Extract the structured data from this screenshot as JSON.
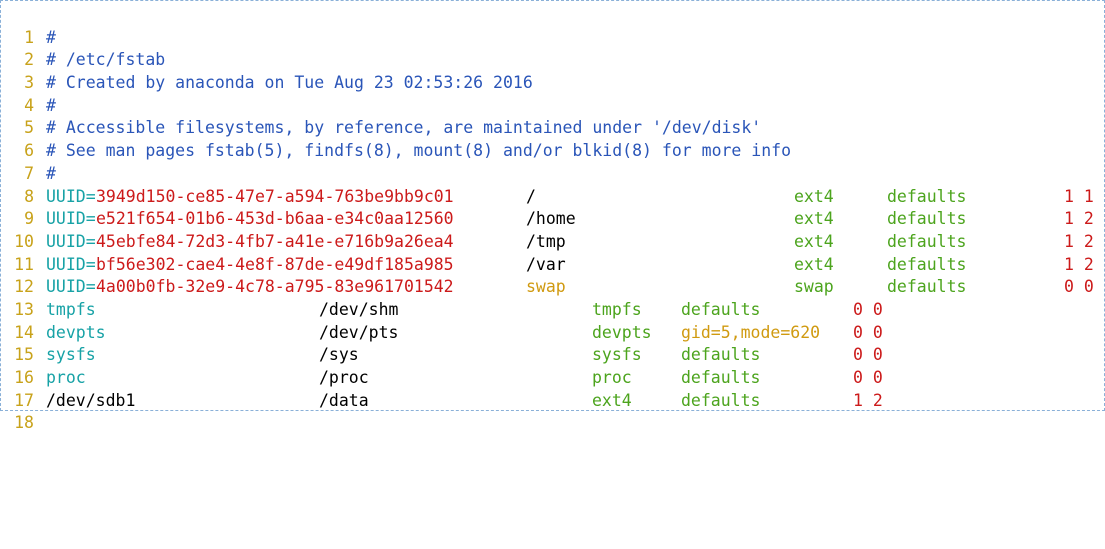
{
  "editor": {
    "line_numbers": [
      "1",
      "2",
      "3",
      "4",
      "5",
      "6",
      "7",
      "8",
      "9",
      "10",
      "11",
      "12",
      "13",
      "14",
      "15",
      "16",
      "17",
      "18"
    ],
    "comments": {
      "l2": "#",
      "l3": "# /etc/fstab",
      "l4": "# Created by anaconda on Tue Aug 23 02:53:26 2016",
      "l5": "#",
      "l6": "# Accessible filesystems, by reference, are maintained under '/dev/disk'",
      "l7": "# See man pages fstab(5), findfs(8), mount(8) and/or blkid(8) for more info",
      "l8": "#"
    },
    "uuid_rows": [
      {
        "key": "UUID=",
        "uuid": "3949d150-ce85-47e7-a594-763be9bb9c01",
        "mount": "/",
        "type": "ext4",
        "options": "defaults",
        "dump_pass": "1 1"
      },
      {
        "key": "UUID=",
        "uuid": "e521f654-01b6-453d-b6aa-e34c0aa12560",
        "mount": "/home",
        "type": "ext4",
        "options": "defaults",
        "dump_pass": "1 2"
      },
      {
        "key": "UUID=",
        "uuid": "45ebfe84-72d3-4fb7-a41e-e716b9a26ea4",
        "mount": "/tmp",
        "type": "ext4",
        "options": "defaults",
        "dump_pass": "1 2"
      },
      {
        "key": "UUID=",
        "uuid": "bf56e302-cae4-4e8f-87de-e49df185a985",
        "mount": "/var",
        "type": "ext4",
        "options": "defaults",
        "dump_pass": "1 2"
      },
      {
        "key": "UUID=",
        "uuid": "4a00b0fb-32e9-4c78-a795-83e961701542",
        "mount": "swap",
        "type": "swap",
        "options": "defaults",
        "dump_pass": "0 0"
      }
    ],
    "pseudo_rows": [
      {
        "device": "tmpfs",
        "mount": "/dev/shm",
        "type": "tmpfs",
        "options": "defaults",
        "dump_pass": "0 0"
      },
      {
        "device": "devpts",
        "mount": "/dev/pts",
        "type": "devpts",
        "options": "gid=5,mode=620",
        "dump_pass": "0 0"
      },
      {
        "device": "sysfs",
        "mount": "/sys",
        "type": "sysfs",
        "options": "defaults",
        "dump_pass": "0 0"
      },
      {
        "device": "proc",
        "mount": "/proc",
        "type": "proc",
        "options": "defaults",
        "dump_pass": "0 0"
      },
      {
        "device": "/dev/sdb1",
        "mount": "/data",
        "type": "ext4",
        "options": "defaults",
        "dump_pass": "1 2"
      }
    ]
  },
  "colors": {
    "line_number": "#c8a21a",
    "comment": "#2a55b8",
    "keyword": "#17a2a6",
    "uuid": "#cc1a1a",
    "fs_type": "#4ca41d",
    "options_special": "#d09a10",
    "border": "#8ab0d8"
  }
}
